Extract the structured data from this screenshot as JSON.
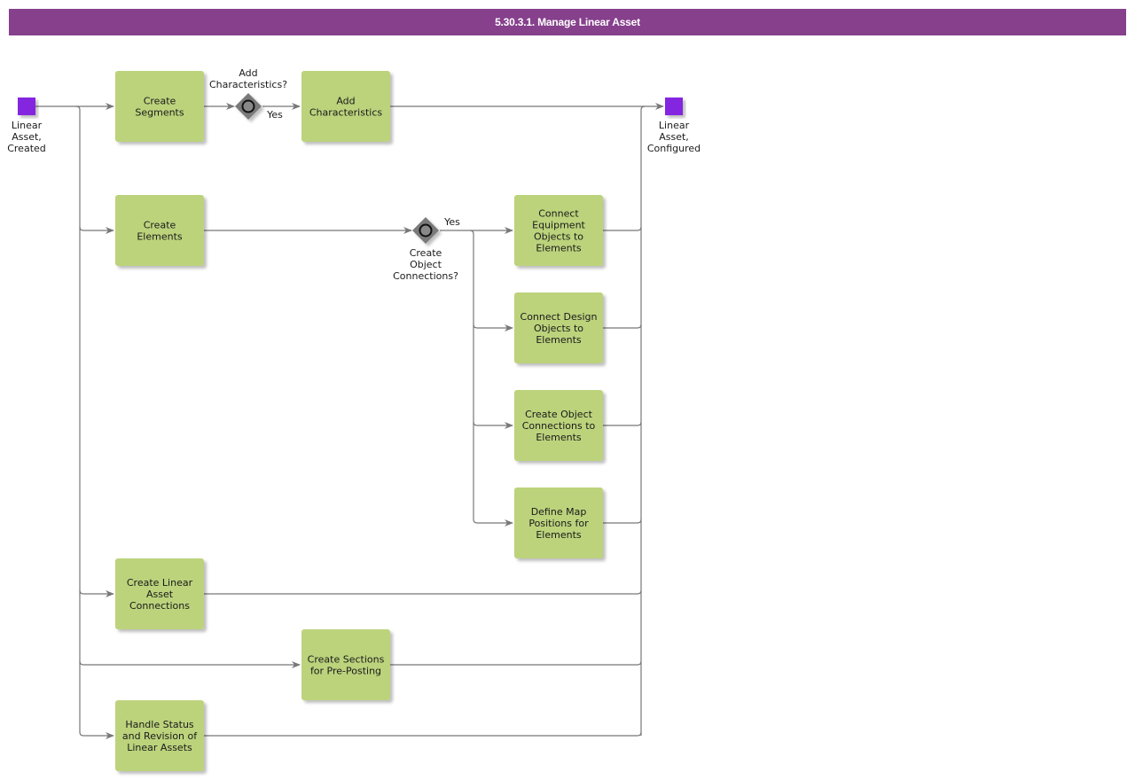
{
  "header": {
    "title": "5.30.3.1. Manage Linear Asset"
  },
  "colors": {
    "header_bg": "#86408c",
    "task_fill": "#bcd37c",
    "event_fill": "#8428e0",
    "gateway_fill": "#7a7a7a",
    "connector": "#777777"
  },
  "events": {
    "start": {
      "label": [
        "Linear",
        "Asset,",
        "Created"
      ],
      "type": "start-event"
    },
    "end": {
      "label": [
        "Linear",
        "Asset,",
        "Configured"
      ],
      "type": "end-event"
    }
  },
  "gateways": {
    "add_characteristics": {
      "label": [
        "Add",
        "Characteristics?"
      ],
      "yes_label": "Yes"
    },
    "create_object_connections": {
      "label": [
        "Create",
        "Object",
        "Connections?"
      ],
      "yes_label": "Yes"
    }
  },
  "tasks": {
    "create_segments": [
      "Create",
      "Segments"
    ],
    "add_characteristics": [
      "Add",
      "Characteristics"
    ],
    "create_elements": [
      "Create",
      "Elements"
    ],
    "connect_equipment": [
      "Connect",
      "Equipment",
      "Objects to",
      "Elements"
    ],
    "connect_design": [
      "Connect Design",
      "Objects to",
      "Elements"
    ],
    "create_object_connections": [
      "Create Object",
      "Connections to",
      "Elements"
    ],
    "define_map_positions": [
      "Define Map",
      "Positions for",
      "Elements"
    ],
    "create_linear_asset_connections": [
      "Create Linear",
      "Asset",
      "Connections"
    ],
    "create_sections": [
      "Create Sections",
      "for Pre-Posting"
    ],
    "handle_status": [
      "Handle Status",
      "and Revision of",
      "Linear Assets"
    ]
  }
}
